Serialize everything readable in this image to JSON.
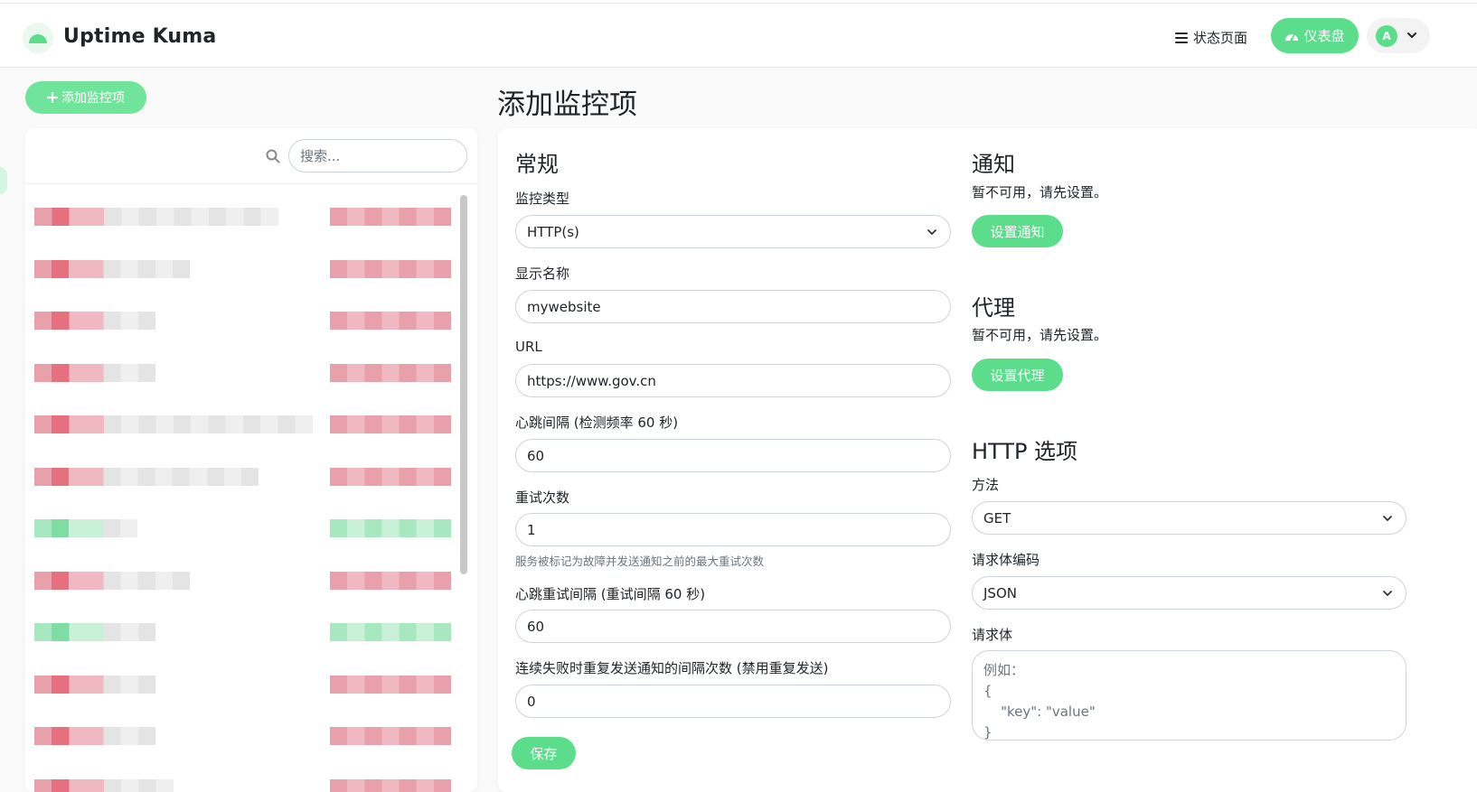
{
  "app": {
    "name": "Uptime Kuma"
  },
  "header": {
    "status_page_label": "状态页面",
    "dashboard_label": "仪表盘",
    "avatar_initial": "A"
  },
  "sidebar": {
    "add_monitor_label": "添加监控项",
    "search_placeholder": "搜索...",
    "monitors": [
      {
        "status": "down"
      },
      {
        "status": "down"
      },
      {
        "status": "down"
      },
      {
        "status": "down"
      },
      {
        "status": "down"
      },
      {
        "status": "down"
      },
      {
        "status": "up"
      },
      {
        "status": "down"
      },
      {
        "status": "up"
      },
      {
        "status": "down"
      },
      {
        "status": "down"
      },
      {
        "status": "down"
      }
    ]
  },
  "page": {
    "title": "添加监控项"
  },
  "general": {
    "heading": "常规",
    "monitor_type_label": "监控类型",
    "monitor_type_value": "HTTP(s)",
    "friendly_name_label": "显示名称",
    "friendly_name_value": "mywebsite",
    "url_label": "URL",
    "url_value": "https://www.gov.cn",
    "interval_label": "心跳间隔 (检测频率 60 秒)",
    "interval_value": "60",
    "retries_label": "重试次数",
    "retries_value": "1",
    "retries_help": "服务被标记为故障并发送通知之前的最大重试次数",
    "retry_interval_label": "心跳重试间隔 (重试间隔 60 秒)",
    "retry_interval_value": "60",
    "resend_label": "连续失败时重复发送通知的间隔次数 (禁用重复发送)",
    "resend_value": "0",
    "save_label": "保存"
  },
  "notifications": {
    "heading": "通知",
    "unavailable_text": "暂不可用，请先设置。",
    "setup_label": "设置通知"
  },
  "proxy": {
    "heading": "代理",
    "unavailable_text": "暂不可用，请先设置。",
    "setup_label": "设置代理"
  },
  "http_options": {
    "heading": "HTTP 选项",
    "method_label": "方法",
    "method_value": "GET",
    "body_encoding_label": "请求体编码",
    "body_encoding_value": "JSON",
    "body_label": "请求体",
    "body_placeholder": "例如：\n{\n    \"key\": \"value\"\n}"
  },
  "colors": {
    "accent": "#5cdd8b",
    "down": "#dc3545",
    "up": "#5cdd8b"
  }
}
